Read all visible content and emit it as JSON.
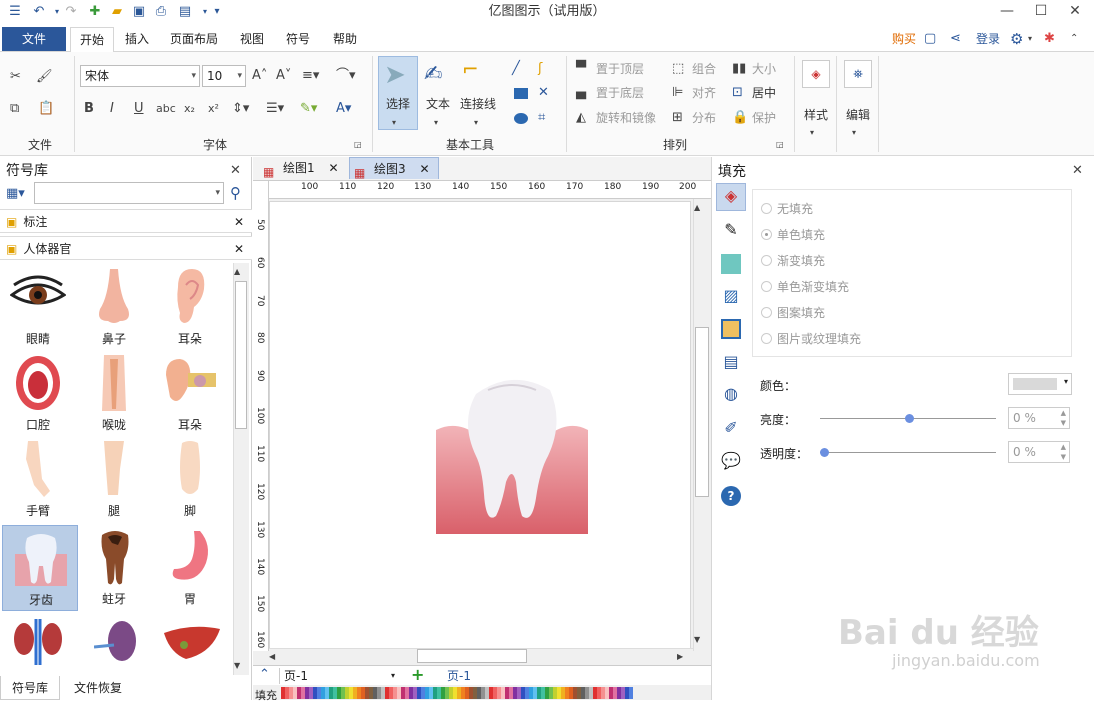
{
  "window": {
    "title": "亿图图示（试用版）"
  },
  "menu": {
    "file": "文件",
    "tabs": [
      "开始",
      "插入",
      "页面布局",
      "视图",
      "符号",
      "帮助"
    ],
    "buy": "购买",
    "login": "登录"
  },
  "ribbon": {
    "font_name": "宋体",
    "font_size": "10",
    "groups": {
      "file": "文件",
      "font": "字体",
      "basic_tools": "基本工具",
      "arrange": "排列"
    },
    "tools": {
      "select": "选择",
      "text": "文本",
      "connector": "连接线"
    },
    "arrange": {
      "bring_front": "置于顶层",
      "send_back": "置于底层",
      "rotate": "旋转和镜像",
      "group": "组合",
      "align": "对齐",
      "distribute": "分布",
      "size": "大小",
      "center": "居中",
      "protect": "保护"
    },
    "style": "样式",
    "edit": "编辑"
  },
  "library": {
    "title": "符号库",
    "search_placeholder": "",
    "categories": [
      "标注",
      "人体器官"
    ],
    "shapes": [
      "眼睛",
      "鼻子",
      "耳朵",
      "口腔",
      "喉咙",
      "耳朵",
      "手臂",
      "腿",
      "脚",
      "牙齿",
      "蛀牙",
      "胃"
    ],
    "bottom_tabs": [
      "符号库",
      "文件恢复"
    ]
  },
  "documents": {
    "tabs": [
      "绘图1",
      "绘图3"
    ]
  },
  "ruler": {
    "h": [
      "100",
      "110",
      "120",
      "130",
      "140",
      "150",
      "160",
      "170",
      "180",
      "190",
      "200"
    ],
    "v": [
      "50",
      "60",
      "70",
      "80",
      "90",
      "100",
      "110",
      "120",
      "130",
      "140",
      "150",
      "160"
    ]
  },
  "pages": {
    "current": "页-1",
    "tab": "页-1"
  },
  "fill_bar": {
    "label": "填充"
  },
  "fill_panel": {
    "title": "填充",
    "options": [
      "无填充",
      "单色填充",
      "渐变填充",
      "单色渐变填充",
      "图案填充",
      "图片或纹理填充"
    ],
    "color_label": "颜色：",
    "brightness_label": "亮度：",
    "brightness_value": "0 %",
    "transparency_label": "透明度：",
    "transparency_value": "0 %"
  },
  "watermark": {
    "text": "Bai du 经验",
    "url": "jingyan.baidu.com"
  },
  "colors": {
    "accent": "#2b579a",
    "tooth_gum": "#d9606a",
    "tooth": "#f2f0f4"
  }
}
